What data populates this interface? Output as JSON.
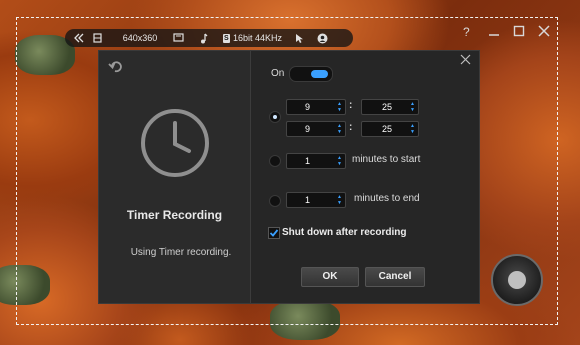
{
  "toolbar": {
    "resolution": "640x360",
    "audio_format": "16bit 44KHz",
    "audio_badge": "S"
  },
  "dialog": {
    "title": "Timer Recording",
    "description": "Using Timer recording.",
    "toggle_label": "On",
    "start_hour": "9",
    "start_minute": "25",
    "end_hour": "9",
    "end_minute": "25",
    "colon": ":",
    "minutes_start_value": "1",
    "minutes_start_label": "minutes to start",
    "minutes_end_value": "1",
    "minutes_end_label": "minutes to end",
    "shutdown_label": "Shut down after recording",
    "ok_label": "OK",
    "cancel_label": "Cancel"
  },
  "colors": {
    "accent": "#3aa0ff",
    "dialog_bg": "#262626"
  },
  "icons": [
    "collapse-icon",
    "film-icon",
    "screen-icon",
    "music-icon",
    "audio-badge-icon",
    "cursor-icon",
    "webcam-icon",
    "help-icon",
    "minimize-icon",
    "maximize-icon",
    "close-icon",
    "back-icon",
    "clock-icon",
    "dialog-close-icon",
    "record-button-icon"
  ]
}
